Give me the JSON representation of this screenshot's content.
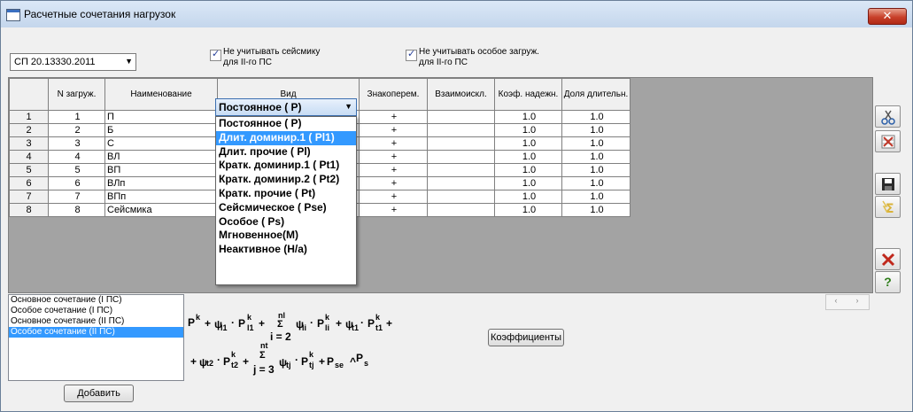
{
  "window": {
    "title": "Расчетные сочетания нагрузок",
    "close_label": "✕"
  },
  "norm_select": {
    "value": "СП 20.13330.2011"
  },
  "checkboxes": [
    {
      "label1": "Не учитывать сейсмику",
      "label2": "для II-го ПС",
      "checked": true
    },
    {
      "label1": "Не учитывать особое загруж.",
      "label2": "для II-го ПС",
      "checked": true
    }
  ],
  "table": {
    "headers": [
      "",
      "N загруж.",
      "Наименование",
      "Вид",
      "Знакоперем.",
      "Взаимоискл.",
      "Коэф. надежн.",
      "Доля длительн."
    ],
    "rows": [
      [
        "1",
        "1",
        "П",
        "Постоянное ( P)",
        "+",
        "",
        "1.0",
        "1.0"
      ],
      [
        "2",
        "2",
        "Б",
        "",
        "+",
        "",
        "1.0",
        "1.0"
      ],
      [
        "3",
        "3",
        "С",
        "",
        "+",
        "",
        "1.0",
        "1.0"
      ],
      [
        "4",
        "4",
        "ВЛ",
        "",
        "+",
        "",
        "1.0",
        "1.0"
      ],
      [
        "5",
        "5",
        "ВП",
        "",
        "+",
        "",
        "1.0",
        "1.0"
      ],
      [
        "6",
        "6",
        "ВЛп",
        "",
        "+",
        "",
        "1.0",
        "1.0"
      ],
      [
        "7",
        "7",
        "ВПп",
        "",
        "+",
        "",
        "1.0",
        "1.0"
      ],
      [
        "8",
        "8",
        "Сейсмика",
        "",
        "+",
        "",
        "1.0",
        "1.0"
      ]
    ]
  },
  "vid_dropdown": {
    "current": "Постоянное ( P)",
    "options": [
      "Постоянное ( P)",
      "Длит. доминир.1 ( Pl1)",
      "Длит. прочие ( Pl)",
      "Кратк. доминир.1 ( Pt1)",
      "Кратк. доминир.2 ( Pt2)",
      "Кратк. прочие ( Pt)",
      "Сейсмическое ( Pse)",
      "Особое ( Ps)",
      "Мгновенное(M)",
      "Неактивное (Н/а)"
    ],
    "selected_index": 1
  },
  "combinations": {
    "items": [
      "Основное сочетание (I ПС)",
      "Особое сочетание (I ПС)",
      "Основное сочетание (II ПС)",
      "Особое сочетание (II ПС)"
    ],
    "selected_index": 3
  },
  "buttons": {
    "add": "Добавить",
    "coefficients": "Коэффициенты"
  },
  "toolbar_icons": [
    "scissors-icon",
    "delete-grid-icon",
    "save-icon",
    "sum-icon",
    "close-x-icon",
    "help-icon"
  ],
  "help_label": "?",
  "formula": {
    "P": "P",
    "k": "k",
    "psi": "ψ",
    "plus": "+",
    "sigma": "Σ",
    "dot": "·",
    "l1": "l1",
    "li": "li",
    "t1": "t1",
    "t2": "t2",
    "tj": "tj",
    "se": "se",
    "s": "s",
    "nl": "nl",
    "nt": "nt",
    "i2": "i = 2",
    "j3": "j = 3",
    "caret": "^",
    "plus_space": " +"
  },
  "scroll_arrows": {
    "left": "‹",
    "right": "›"
  }
}
